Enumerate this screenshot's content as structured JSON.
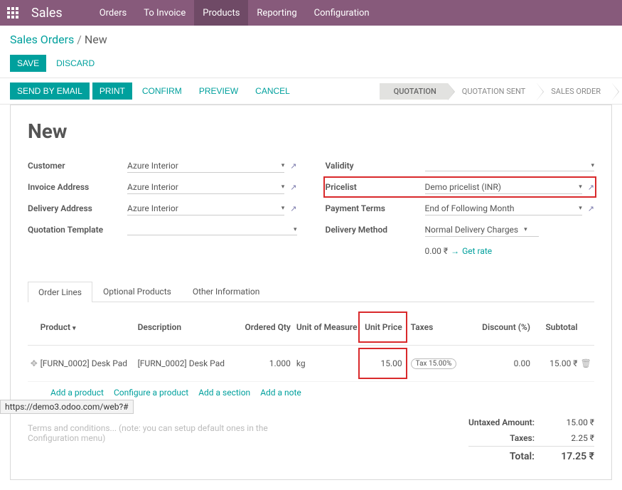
{
  "topbar": {
    "app_title": "Sales",
    "menu": [
      "Orders",
      "To Invoice",
      "Products",
      "Reporting",
      "Configuration"
    ],
    "active_index": 2
  },
  "breadcrumb": {
    "parent": "Sales Orders",
    "current": "New"
  },
  "buttons": {
    "save": "SAVE",
    "discard": "DISCARD"
  },
  "toolbar": {
    "send_email": "SEND BY EMAIL",
    "print": "PRINT",
    "confirm": "CONFIRM",
    "preview": "PREVIEW",
    "cancel": "CANCEL"
  },
  "statusbar": [
    "QUOTATION",
    "QUOTATION SENT",
    "SALES ORDER"
  ],
  "statusbar_active": 0,
  "page_title": "New",
  "left_fields": {
    "customer_label": "Customer",
    "customer": "Azure Interior",
    "invoice_addr_label": "Invoice Address",
    "invoice_addr": "Azure Interior",
    "delivery_addr_label": "Delivery Address",
    "delivery_addr": "Azure Interior",
    "quote_tmpl_label": "Quotation Template",
    "quote_tmpl": ""
  },
  "right_fields": {
    "validity_label": "Validity",
    "validity": "",
    "pricelist_label": "Pricelist",
    "pricelist": "Demo pricelist (INR)",
    "payment_terms_label": "Payment Terms",
    "payment_terms": "End of Following Month",
    "delivery_method_label": "Delivery Method",
    "delivery_method": "Normal Delivery Charges",
    "rate_amount": "0.00 ₹",
    "get_rate": "Get rate"
  },
  "tabs": [
    "Order Lines",
    "Optional Products",
    "Other Information"
  ],
  "tabs_active": 0,
  "grid_head": {
    "product": "Product",
    "description": "Description",
    "ordered_qty": "Ordered Qty",
    "uom": "Unit of Measure",
    "unit_price": "Unit Price",
    "taxes": "Taxes",
    "discount": "Discount (%)",
    "subtotal": "Subtotal"
  },
  "grid_rows": [
    {
      "product": "[FURN_0002] Desk Pad",
      "description": "[FURN_0002] Desk Pad",
      "qty": "1.000",
      "uom": "kg",
      "price": "15.00",
      "tax": "Tax 15.00%",
      "discount": "0.00",
      "subtotal": "15.00 ₹"
    }
  ],
  "line_actions": {
    "add_product": "Add a product",
    "configure": "Configure a product",
    "add_section": "Add a section",
    "add_note": "Add a note"
  },
  "terms_placeholder": "Terms and conditions... (note: you can setup default ones in the Configuration menu)",
  "totals": {
    "untaxed_label": "Untaxed Amount:",
    "untaxed": "15.00 ₹",
    "taxes_label": "Taxes:",
    "taxes": "2.25 ₹",
    "total_label": "Total:",
    "total": "17.25 ₹"
  },
  "status_url": "https://demo3.odoo.com/web?#"
}
